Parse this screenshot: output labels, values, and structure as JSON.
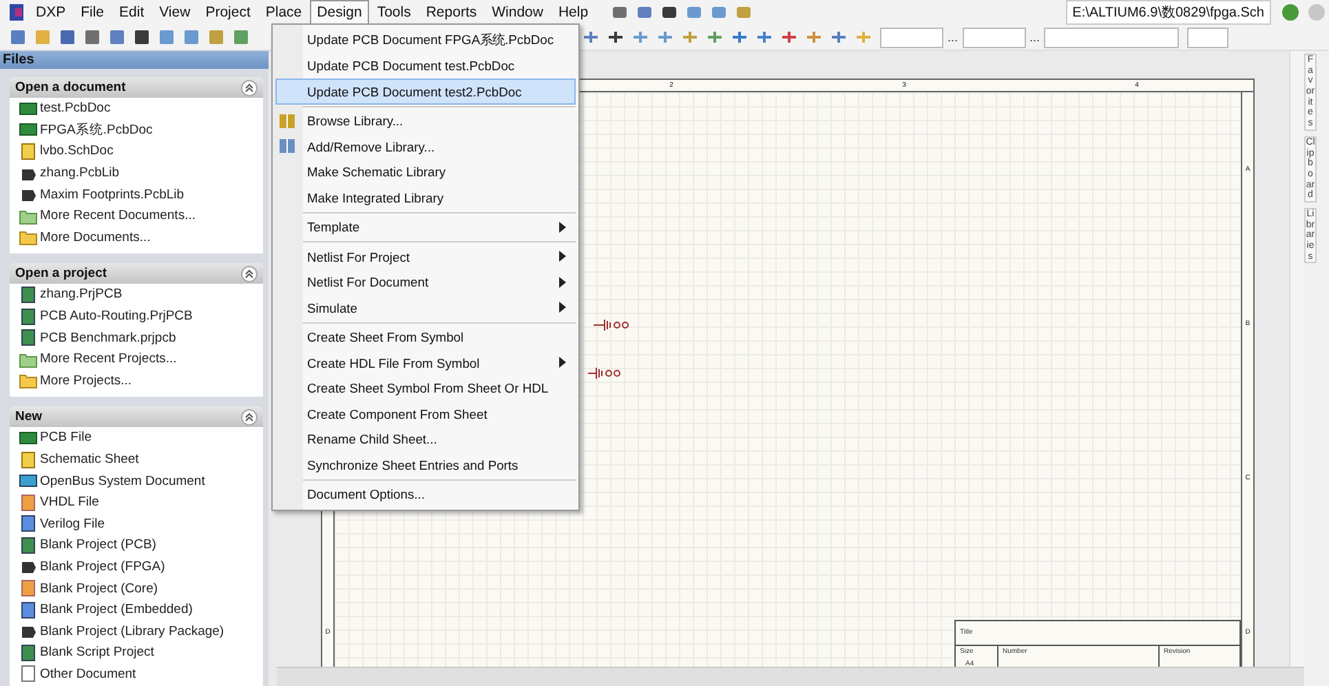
{
  "menubar": {
    "app": "DXP",
    "items": [
      {
        "label": "File",
        "selected": false
      },
      {
        "label": "Edit",
        "selected": false
      },
      {
        "label": "View",
        "selected": false
      },
      {
        "label": "Project",
        "selected": false
      },
      {
        "label": "Place",
        "selected": false
      },
      {
        "label": "Design",
        "selected": true
      },
      {
        "label": "Tools",
        "selected": false
      },
      {
        "label": "Reports",
        "selected": false
      },
      {
        "label": "Window",
        "selected": false
      },
      {
        "label": "Help",
        "selected": false
      }
    ],
    "path": "E:\\ALTIUM6.9\\数0829\\fpga.Sch"
  },
  "toolbar": {
    "ellipses": [
      "...",
      "..."
    ]
  },
  "files_panel": {
    "title": "Files",
    "sections": [
      {
        "title": "Open a document",
        "items": [
          {
            "label": "test.PcbDoc",
            "kind": "pcb"
          },
          {
            "label": "FPGA系统.PcbDoc",
            "kind": "pcb"
          },
          {
            "label": "lvbo.SchDoc",
            "kind": "sch"
          },
          {
            "label": "zhang.PcbLib",
            "kind": "lib"
          },
          {
            "label": "Maxim Footprints.PcbLib",
            "kind": "lib"
          },
          {
            "label": "More Recent Documents...",
            "kind": "folder"
          },
          {
            "label": "More Documents...",
            "kind": "open-folder"
          }
        ]
      },
      {
        "title": "Open a project",
        "items": [
          {
            "label": "zhang.PrjPCB",
            "kind": "project"
          },
          {
            "label": "PCB Auto-Routing.PrjPCB",
            "kind": "project"
          },
          {
            "label": "PCB Benchmark.prjpcb",
            "kind": "project"
          },
          {
            "label": "More Recent Projects...",
            "kind": "folder"
          },
          {
            "label": "More Projects...",
            "kind": "open-folder"
          }
        ]
      },
      {
        "title": "New",
        "items": [
          {
            "label": "PCB File",
            "kind": "pcb"
          },
          {
            "label": "Schematic Sheet",
            "kind": "sch"
          },
          {
            "label": "OpenBus System Document",
            "kind": "screen"
          },
          {
            "label": "VHDL File",
            "kind": "orange-doc"
          },
          {
            "label": "Verilog File",
            "kind": "blue-doc"
          },
          {
            "label": "Blank Project (PCB)",
            "kind": "project"
          },
          {
            "label": "Blank Project (FPGA)",
            "kind": "lib"
          },
          {
            "label": "Blank Project (Core)",
            "kind": "orange-doc"
          },
          {
            "label": "Blank Project (Embedded)",
            "kind": "blue-doc"
          },
          {
            "label": "Blank Project (Library Package)",
            "kind": "lib"
          },
          {
            "label": "Blank Script Project",
            "kind": "project"
          },
          {
            "label": "Other Document",
            "kind": "doc"
          }
        ]
      }
    ]
  },
  "design_menu": {
    "groups": [
      [
        {
          "label": "Update PCB Document FPGA系统.PcbDoc",
          "selected": false,
          "submenu": false
        },
        {
          "label": "Update PCB Document test.PcbDoc",
          "selected": false,
          "submenu": false
        },
        {
          "label": "Update PCB Document test2.PcbDoc",
          "selected": true,
          "submenu": false
        }
      ],
      [
        {
          "label": "Browse Library...",
          "selected": false,
          "submenu": false,
          "kind": "icon"
        },
        {
          "label": "Add/Remove Library...",
          "selected": false,
          "submenu": false,
          "kind": "icon"
        },
        {
          "label": "Make Schematic Library",
          "selected": false,
          "submenu": false
        },
        {
          "label": "Make Integrated Library",
          "selected": false,
          "submenu": false
        }
      ],
      [
        {
          "label": "Template",
          "selected": false,
          "submenu": true
        }
      ],
      [
        {
          "label": "Netlist For Project",
          "selected": false,
          "submenu": true
        },
        {
          "label": "Netlist For Document",
          "selected": false,
          "submenu": true
        },
        {
          "label": "Simulate",
          "selected": false,
          "submenu": true
        }
      ],
      [
        {
          "label": "Create Sheet From Symbol",
          "selected": false,
          "submenu": false
        },
        {
          "label": "Create HDL File From Symbol",
          "selected": false,
          "submenu": true
        },
        {
          "label": "Create Sheet Symbol From Sheet Or HDL",
          "selected": false,
          "submenu": false
        },
        {
          "label": "Create Component From Sheet",
          "selected": false,
          "submenu": false
        },
        {
          "label": "Rename Child Sheet...",
          "selected": false,
          "submenu": false
        },
        {
          "label": "Synchronize Sheet Entries and Ports",
          "selected": false,
          "submenu": false
        }
      ],
      [
        {
          "label": "Document Options...",
          "selected": false,
          "submenu": false
        }
      ]
    ]
  },
  "sheet": {
    "column_labels": [
      "2",
      "3",
      "4"
    ],
    "right_row_labels": [
      "A",
      "B",
      "C",
      "D"
    ],
    "left_row_labels": [
      "D"
    ],
    "title_block": {
      "title": "Title",
      "size": "Size",
      "size_value": "A4",
      "number": "Number",
      "revision": "Revision"
    }
  },
  "side_tabs": [
    "Favorites",
    "Clipboard",
    "Libraries"
  ]
}
